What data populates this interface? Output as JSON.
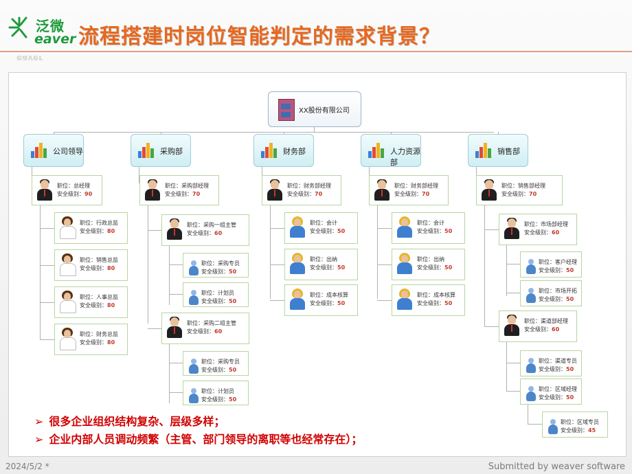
{
  "header": {
    "logo_cn": "泛微",
    "logo_en": "eaver",
    "title": "流程搭建时岗位智能判定的需求背景？"
  },
  "org": {
    "root": "XX股份有限公司",
    "departments": [
      {
        "name": "公司领导",
        "head": {
          "title": "职位：总经理",
          "level_label": "安全级别：",
          "level": "90"
        },
        "members": [
          {
            "title": "职位：行政总监",
            "level_label": "安全级别：",
            "level": "80"
          },
          {
            "title": "职位：销售总监",
            "level_label": "安全级别：",
            "level": "80"
          },
          {
            "title": "职位：人事总监",
            "level_label": "安全级别：",
            "level": "80"
          },
          {
            "title": "职位：财务总监",
            "level_label": "安全级别：",
            "level": "80"
          }
        ]
      },
      {
        "name": "采购部",
        "head": {
          "title": "职位：采购部经理",
          "level_label": "安全级别：",
          "level": "70"
        },
        "groups": [
          {
            "head": {
              "title": "职位：采购一组主管",
              "level_label": "安全级别：",
              "level": "60"
            },
            "members": [
              {
                "title": "职位：采购专员",
                "level_label": "安全级别：",
                "level": "50"
              },
              {
                "title": "职位：计划员",
                "level_label": "安全级别：",
                "level": "50"
              }
            ]
          },
          {
            "head": {
              "title": "职位：采购二组主管",
              "level_label": "安全级别：",
              "level": "60"
            },
            "members": [
              {
                "title": "职位：采购专员",
                "level_label": "安全级别：",
                "level": "50"
              },
              {
                "title": "职位：计划员",
                "level_label": "安全级别：",
                "level": "50"
              }
            ]
          }
        ]
      },
      {
        "name": "财务部",
        "head": {
          "title": "职位：财务部经理",
          "level_label": "安全级别：",
          "level": "70"
        },
        "members": [
          {
            "title": "职位：会计",
            "level_label": "安全级别：",
            "level": "50"
          },
          {
            "title": "职位：出纳",
            "level_label": "安全级别：",
            "level": "50"
          },
          {
            "title": "职位：成本核算",
            "level_label": "安全级别：",
            "level": "50"
          }
        ]
      },
      {
        "name": "人力资源部",
        "head": {
          "title": "职位：财务部经理",
          "level_label": "安全级别：",
          "level": "70"
        },
        "members": [
          {
            "title": "职位：会计",
            "level_label": "安全级别：",
            "level": "50"
          },
          {
            "title": "职位：出纳",
            "level_label": "安全级别：",
            "level": "50"
          },
          {
            "title": "职位：成本核算",
            "level_label": "安全级别：",
            "level": "50"
          }
        ]
      },
      {
        "name": "销售部",
        "head": {
          "title": "职位：销售部经理",
          "level_label": "安全级别：",
          "level": "70"
        },
        "groups": [
          {
            "head": {
              "title": "职位：市场部经理",
              "level_label": "安全级别：",
              "level": "60"
            },
            "members": [
              {
                "title": "职位：客户经理",
                "level_label": "安全级别：",
                "level": "50"
              },
              {
                "title": "职位：市场开拓",
                "level_label": "安全级别：",
                "level": "50"
              }
            ]
          },
          {
            "head": {
              "title": "职位：渠道部经理",
              "level_label": "安全级别：",
              "level": "60"
            },
            "members": [
              {
                "title": "职位：渠道专员",
                "level_label": "安全级别：",
                "level": "50"
              },
              {
                "title": "职位：区域经理",
                "level_label": "安全级别：",
                "level": "50"
              },
              {
                "title": "职位：区域专员",
                "level_label": "安全级别：",
                "level": "45"
              }
            ]
          }
        ]
      }
    ]
  },
  "bullets": [
    "很多企业组织结构复杂、层级多样；",
    "企业内部人员调动频繁（主管、部门领导的离职等也经常存在）；"
  ],
  "footer": {
    "date": "2024/5/2 *",
    "submitted": "Submitted by weaver software"
  }
}
